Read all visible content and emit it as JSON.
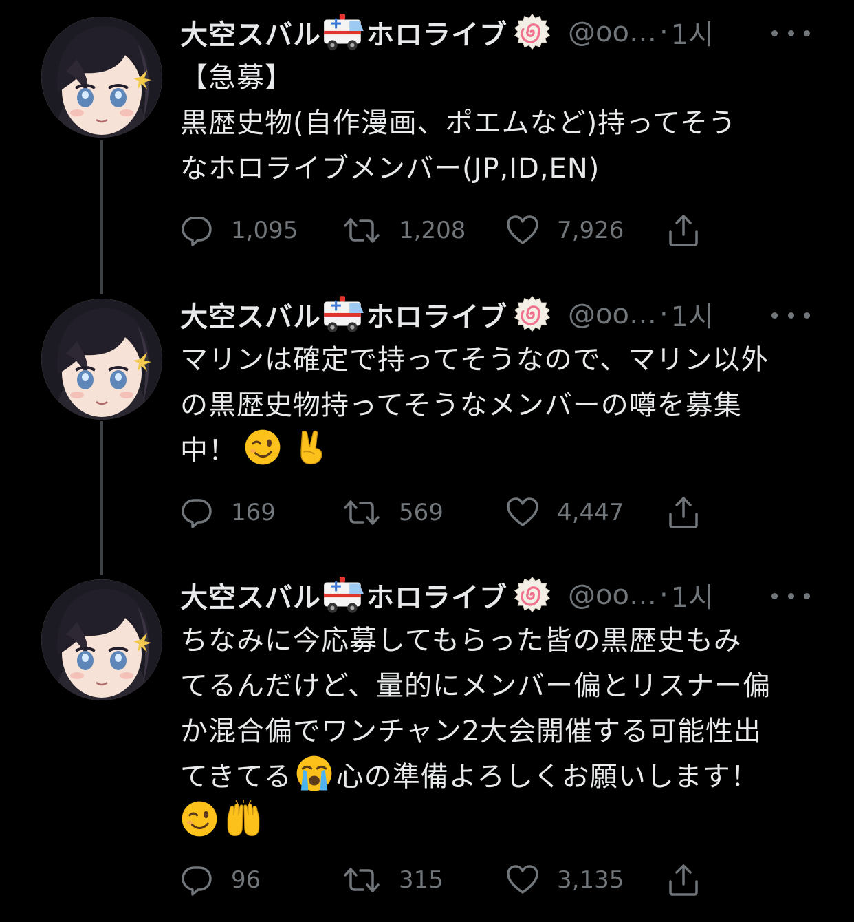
{
  "colors": {
    "background": "#000000",
    "primary_text": "#e7e9ea",
    "secondary_text": "#71767b",
    "thread_line": "#3e4144"
  },
  "icons": {
    "reply": "reply-icon",
    "retweet": "retweet-icon",
    "like": "heart-icon",
    "share": "share-icon",
    "more": "more-icon",
    "ambulance_emoji": "ambulance-emoji",
    "narutomaki_emoji": "fish-cake-emoji",
    "wink_emoji": "winking-face-emoji",
    "victory_emoji": "victory-hand-emoji",
    "crying_emoji": "loudly-crying-face-emoji",
    "raising_hands_emoji": "raising-hands-emoji"
  },
  "tweets": [
    {
      "name_part1": "大空スバル",
      "name_part2": "ホロライブ",
      "handle": "@oo…",
      "separator": "·",
      "time": "1시",
      "lines": [
        "【急募】",
        "黒歴史物(自作漫画、ポエムなど)持ってそう",
        "なホロライブメンバー(JP,ID,EN)"
      ],
      "replies": "1,095",
      "retweets": "1,208",
      "likes": "7,926"
    },
    {
      "name_part1": "大空スバル",
      "name_part2": "ホロライブ",
      "handle": "@oo…",
      "separator": "·",
      "time": "1시",
      "lines": [
        "マリンは確定で持ってそうなので、マリン以外",
        "の黒歴史物持ってそうなメンバーの噂を募集",
        "中！"
      ],
      "replies": "169",
      "retweets": "569",
      "likes": "4,447"
    },
    {
      "name_part1": "大空スバル",
      "name_part2": "ホロライブ",
      "handle": "@oo…",
      "separator": "·",
      "time": "1시",
      "lines": [
        "ちなみに今応募してもらった皆の黒歴史もみ",
        "てるんだけど、量的にメンバー偏とリスナー偏",
        "か混合偏でワンチャン2大会開催する可能性出",
        "てきてる",
        "心の準備よろしくお願いします！"
      ],
      "replies": "96",
      "retweets": "315",
      "likes": "3,135"
    }
  ]
}
